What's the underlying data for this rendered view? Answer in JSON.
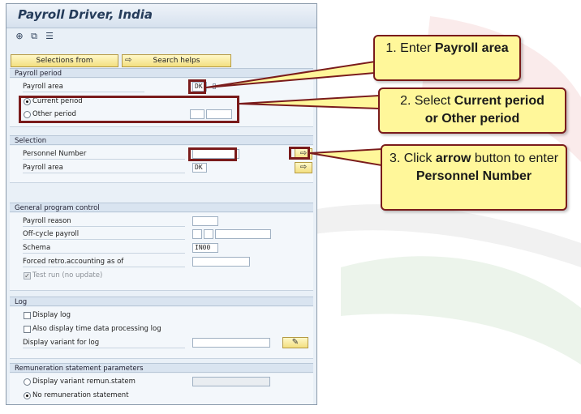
{
  "window": {
    "title": "Payroll Driver, India"
  },
  "toolbar": {
    "icons": [
      "execute-icon",
      "variant-icon",
      "list-icon"
    ]
  },
  "buttons": {
    "selections_from": "Selections from",
    "search_helps": "Search helps"
  },
  "payroll_period": {
    "header": "Payroll period",
    "payroll_area_label": "Payroll area",
    "payroll_area_value": "DK",
    "current_period_label": "Current period",
    "other_period_label": "Other period",
    "current_period_selected": true
  },
  "selection": {
    "header": "Selection",
    "personnel_number_label": "Personnel Number",
    "personnel_number_value": "",
    "payroll_area_label": "Payroll area",
    "payroll_area_value": "DK"
  },
  "general": {
    "header": "General program control",
    "payroll_reason_label": "Payroll reason",
    "off_cycle_label": "Off-cycle payroll",
    "schema_label": "Schema",
    "schema_value": "IN00",
    "forced_retro_label": "Forced retro.accounting as of",
    "test_run_label": "Test run (no update)",
    "test_run_checked": true
  },
  "log": {
    "header": "Log",
    "display_log_label": "Display log",
    "also_display_label": "Also display time data processing log",
    "display_variant_label": "Display variant for log"
  },
  "remuneration": {
    "header": "Remuneration statement parameters",
    "display_variant_label": "Display variant remun.statem",
    "no_statement_label": "No remuneration statement",
    "no_statement_selected": true
  },
  "callouts": {
    "step1_prefix": "1. Enter ",
    "step1_bold": "Payroll area",
    "step2_prefix": "2. Select ",
    "step2_bold1": "Current period",
    "step2_mid": "or ",
    "step2_bold2": "Other period",
    "step3_prefix": "3. Click ",
    "step3_bold1": "arrow",
    "step3_mid": " button to enter ",
    "step3_bold2": "Personnel Number"
  },
  "colors": {
    "callout_fill": "#fff79a",
    "highlight_border": "#7a1b1b",
    "sap_panel": "#e9f0f7"
  }
}
